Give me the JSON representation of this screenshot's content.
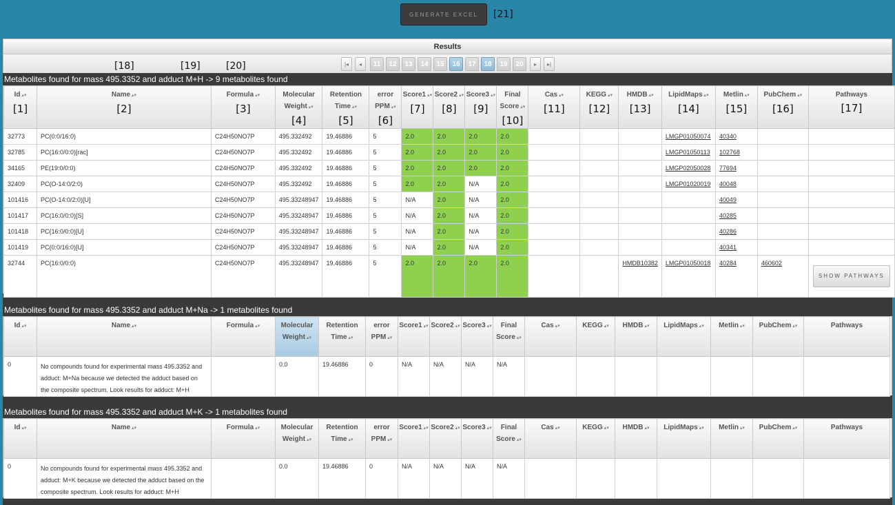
{
  "toolbar": {
    "generate_excel_label": "GENERATE EXCEL",
    "generate_excel_annotation": "[21]"
  },
  "results": {
    "title": "Results",
    "annotations": {
      "a18": "[18]",
      "a19": "[19]",
      "a20": "[20]"
    },
    "pager": {
      "first": "|◂",
      "prev": "◂",
      "next": "▸",
      "last": "▸|",
      "pages": [
        "11",
        "12",
        "13",
        "14",
        "15",
        "16",
        "17",
        "18",
        "19",
        "20"
      ],
      "active_pages": [
        "16",
        "18"
      ]
    }
  },
  "columns": [
    {
      "label": "Id",
      "annot": "[1]"
    },
    {
      "label": "Name",
      "annot": "[2]"
    },
    {
      "label": "Formula",
      "annot": "[3]"
    },
    {
      "label": "Molecular Weight",
      "annot": "[4]"
    },
    {
      "label": "Retention Time",
      "annot": "[5]"
    },
    {
      "label": "error PPM",
      "annot": "[6]"
    },
    {
      "label": "Score1",
      "annot": "[7]"
    },
    {
      "label": "Score2",
      "annot": "[8]"
    },
    {
      "label": "Score3",
      "annot": "[9]"
    },
    {
      "label": "Final Score",
      "annot": "[10]"
    },
    {
      "label": "Cas",
      "annot": "[11]"
    },
    {
      "label": "KEGG",
      "annot": "[12]"
    },
    {
      "label": "HMDB",
      "annot": "[13]"
    },
    {
      "label": "LipidMaps",
      "annot": "[14]"
    },
    {
      "label": "Metlin",
      "annot": "[15]"
    },
    {
      "label": "PubChem",
      "annot": "[16]"
    },
    {
      "label": "Pathways",
      "annot": "[17]"
    }
  ],
  "sections": [
    {
      "heading": "Metabolites found for mass 495.3352 and adduct M+H -> 9 metabolites found",
      "rows": [
        [
          "32773",
          "PC(0:0/16:0)",
          "C24H50NO7P",
          "495.332492",
          "19.46886",
          "5",
          "2.0",
          "2.0",
          "2.0",
          "2.0",
          "",
          "",
          "",
          "LMGP01050074",
          "40340",
          "",
          ""
        ],
        [
          "32785",
          "PC(16:0/0:0)[rac]",
          "C24H50NO7P",
          "495.332492",
          "19.46886",
          "5",
          "2.0",
          "2.0",
          "2.0",
          "2.0",
          "",
          "",
          "",
          "LMGP01050113",
          "102768",
          "",
          ""
        ],
        [
          "34165",
          "PE(19:0/0:0)",
          "C24H50NO7P",
          "495.332492",
          "19.46886",
          "5",
          "2.0",
          "2.0",
          "2.0",
          "2.0",
          "",
          "",
          "",
          "LMGP02050028",
          "77694",
          "",
          ""
        ],
        [
          "32409",
          "PC(O-14:0/2:0)",
          "C24H50NO7P",
          "495.332492",
          "19.46886",
          "5",
          "2.0",
          "2.0",
          "N/A",
          "2.0",
          "",
          "",
          "",
          "LMGP01020019",
          "40048",
          "",
          ""
        ],
        [
          "101416",
          "PC(O-14:0/2:0)[U]",
          "C24H50NO7P",
          "495.33248947",
          "19.46886",
          "5",
          "N/A",
          "2.0",
          "N/A",
          "2.0",
          "",
          "",
          "",
          "",
          "40049",
          "",
          ""
        ],
        [
          "101417",
          "PC(16:0/0:0)[S]",
          "C24H50NO7P",
          "495.33248947",
          "19.46886",
          "5",
          "N/A",
          "2.0",
          "N/A",
          "2.0",
          "",
          "",
          "",
          "",
          "40285",
          "",
          ""
        ],
        [
          "101418",
          "PC(16:0/0:0)[U]",
          "C24H50NO7P",
          "495.33248947",
          "19.46886",
          "5",
          "N/A",
          "2.0",
          "N/A",
          "2.0",
          "",
          "",
          "",
          "",
          "40286",
          "",
          ""
        ],
        [
          "101419",
          "PC(0:0/16:0)[U]",
          "C24H50NO7P",
          "495.33248947",
          "19.46886",
          "5",
          "N/A",
          "2.0",
          "N/A",
          "2.0",
          "",
          "",
          "",
          "",
          "40341",
          "",
          ""
        ],
        [
          "32744",
          "PC(16:0/0:0)",
          "C24H50NO7P",
          "495.33248947",
          "19.46886",
          "5",
          "2.0",
          "2.0",
          "2.0",
          "2.0",
          "",
          "",
          "HMDB10382",
          "LMGP01050018",
          "40284",
          "460602",
          "SHOW PATHWAYS"
        ]
      ]
    },
    {
      "heading": "Metabolites found for mass 495.3352 and adduct M+Na -> 1 metabolites found",
      "rows": [
        [
          "0",
          "No compounds found for experimental mass 495.3352 and adduct: M+Na because we detected the adduct based on the composite spectrum. Look results for adduct: M+H",
          "",
          "0.0",
          "19.46886",
          "0",
          "N/A",
          "N/A",
          "N/A",
          "N/A",
          "",
          "",
          "",
          "",
          "",
          "",
          ""
        ]
      ]
    },
    {
      "heading": "Metabolites found for mass 495.3352 and adduct M+K -> 1 metabolites found",
      "rows": [
        [
          "0",
          "No compounds found for experimental mass 495.3352 and adduct: M+K because we detected the adduct based on the composite spectrum. Look results for adduct: M+H",
          "",
          "0.0",
          "19.46886",
          "0",
          "N/A",
          "N/A",
          "N/A",
          "N/A",
          "",
          "",
          "",
          "",
          "",
          "",
          ""
        ]
      ]
    }
  ],
  "colors": {
    "background": "#2a86a8",
    "score_green": "#8fd14f",
    "section_bar": "#3a3a3a"
  }
}
